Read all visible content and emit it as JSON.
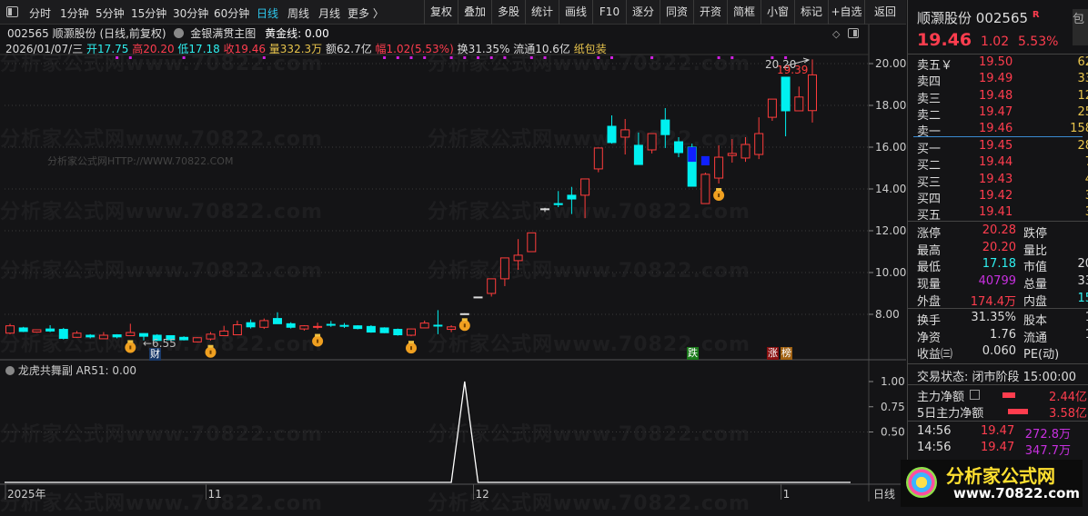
{
  "toolbar": {
    "periods": [
      "分时",
      "1分钟",
      "5分钟",
      "15分钟",
      "30分钟",
      "60分钟",
      "日线",
      "周线",
      "月线",
      "更多 〉"
    ],
    "active_period": "日线",
    "buttons": [
      "复权",
      "叠加",
      "多股",
      "统计",
      "画线",
      "F10",
      "逐分",
      "同资",
      "开资",
      "简框",
      "小窗",
      "标记",
      "+自选",
      "返回"
    ]
  },
  "info": {
    "title": "002565 顺灏股份 (日线,前复权)",
    "indicator": "金银满贯主图",
    "golden_line": "黄金线: 0.00",
    "date": "2026/01/07/三",
    "open": "开17.75",
    "high": "高20.20",
    "low": "低17.18",
    "close": "收19.46",
    "volume": "量332.3万",
    "amount": "额62.7亿",
    "change": "幅1.02(5.53%)",
    "turnover": "换31.35%",
    "float": "流通10.6亿",
    "sector": "纸包装"
  },
  "watermark": "分析家公式网www.70822.com",
  "watermark_small": "分析家公式网HTTP://WWW.70822.COM",
  "chart_data": {
    "type": "candlestick",
    "price_ticks": [
      "20.00",
      "18.00",
      "16.00",
      "14.00",
      "12.00",
      "10.00",
      "8.00"
    ],
    "price_ylim": [
      7.0,
      20.0
    ],
    "candles": [
      [
        7.1,
        7.55,
        7.05,
        7.45
      ],
      [
        7.35,
        7.4,
        7.15,
        7.18
      ],
      [
        7.15,
        7.28,
        7.12,
        7.26
      ],
      [
        7.3,
        7.48,
        7.15,
        7.2
      ],
      [
        7.28,
        7.35,
        6.8,
        6.85
      ],
      [
        6.9,
        7.2,
        6.88,
        7.1
      ],
      [
        7.0,
        7.05,
        6.85,
        6.92
      ],
      [
        6.83,
        7.15,
        6.83,
        7.0
      ],
      [
        7.02,
        7.05,
        6.85,
        6.92
      ],
      [
        6.98,
        7.55,
        6.98,
        7.13
      ],
      [
        7.08,
        7.1,
        6.75,
        6.95
      ],
      [
        7.0,
        7.05,
        6.72,
        6.75
      ],
      [
        6.98,
        7.0,
        6.75,
        6.78
      ],
      [
        6.9,
        6.95,
        6.75,
        6.78
      ],
      [
        6.68,
        6.9,
        6.65,
        6.88
      ],
      [
        6.82,
        7.15,
        6.75,
        7.05
      ],
      [
        6.98,
        7.45,
        6.98,
        7.2
      ],
      [
        7.02,
        7.7,
        7.02,
        7.5
      ],
      [
        7.6,
        7.75,
        7.32,
        7.4
      ],
      [
        7.38,
        7.8,
        7.3,
        7.7
      ],
      [
        7.8,
        8.1,
        7.55,
        7.55
      ],
      [
        7.55,
        7.62,
        7.32,
        7.38
      ],
      [
        7.3,
        7.48,
        7.22,
        7.45
      ],
      [
        7.4,
        7.6,
        7.28,
        7.42
      ],
      [
        7.52,
        7.68,
        7.4,
        7.5
      ],
      [
        7.47,
        7.58,
        7.35,
        7.45
      ],
      [
        7.45,
        7.48,
        7.28,
        7.32
      ],
      [
        7.42,
        7.48,
        7.12,
        7.15
      ],
      [
        7.35,
        7.38,
        7.1,
        7.12
      ],
      [
        7.28,
        7.32,
        6.98,
        7.02
      ],
      [
        7.0,
        7.32,
        6.95,
        7.3
      ],
      [
        7.35,
        7.7,
        7.35,
        7.58
      ],
      [
        7.48,
        8.2,
        7.05,
        7.45
      ],
      [
        7.28,
        7.48,
        7.15,
        7.4
      ],
      [
        8.03,
        8.05,
        8.03,
        8.03
      ],
      [
        8.83,
        8.83,
        8.83,
        8.83
      ],
      [
        9.0,
        9.7,
        8.85,
        9.7
      ],
      [
        9.7,
        10.7,
        9.35,
        10.7
      ],
      [
        10.57,
        11.6,
        10.13,
        10.83
      ],
      [
        11.0,
        11.9,
        11.0,
        11.9
      ],
      [
        13.05,
        13.1,
        12.9,
        13.05
      ],
      [
        13.3,
        13.9,
        13.13,
        13.25
      ],
      [
        13.7,
        14.1,
        12.8,
        13.52
      ],
      [
        13.7,
        14.48,
        12.6,
        14.48
      ],
      [
        14.96,
        15.96,
        14.8,
        15.96
      ],
      [
        17.0,
        17.52,
        16.17,
        16.22
      ],
      [
        16.48,
        17.35,
        15.65,
        16.83
      ],
      [
        16.09,
        16.7,
        15.17,
        15.17
      ],
      [
        15.87,
        16.65,
        15.7,
        16.65
      ],
      [
        17.3,
        17.87,
        15.96,
        16.6
      ],
      [
        16.26,
        16.48,
        15.52,
        15.74
      ],
      [
        16.0,
        16.17,
        14.13,
        14.13
      ],
      [
        13.3,
        14.78,
        13.3,
        14.7
      ],
      [
        14.52,
        16.09,
        14.26,
        15.52
      ],
      [
        15.6,
        16.39,
        15.26,
        15.7
      ],
      [
        15.48,
        16.48,
        15.3,
        16.13
      ],
      [
        15.65,
        17.43,
        15.43,
        16.65
      ],
      [
        17.43,
        18.3,
        17.26,
        18.3
      ],
      [
        19.35,
        19.35,
        16.52,
        17.74
      ],
      [
        17.74,
        18.9,
        17.74,
        18.4
      ],
      [
        17.75,
        20.2,
        17.18,
        19.46
      ]
    ],
    "candle_fields": [
      "open",
      "high",
      "low",
      "close"
    ],
    "neutral_candles": [
      34,
      35,
      40
    ],
    "overlay_blue": [
      [
        51,
        16.0,
        15.3
      ],
      [
        52,
        15.57,
        15.13
      ]
    ],
    "signal_dots": [
      8,
      9,
      13,
      19,
      28,
      29,
      30,
      31,
      33,
      34,
      35,
      36,
      37,
      39,
      40,
      44,
      45,
      48,
      53,
      54,
      57,
      58
    ],
    "moneybag_candles": [
      9,
      15,
      23,
      30,
      34,
      53
    ],
    "annotations": {
      "low_label": "←6.55",
      "high_label": "20.20",
      "high_close_label": "19.39",
      "cai": "财",
      "die": "跌",
      "zhang": "涨",
      "bang": "榜"
    },
    "indicator": {
      "name": "龙虎共舞副",
      "header": "AR51: 0.00",
      "ticks": [
        "1.00",
        "0.75",
        "0.50"
      ],
      "values_nonzero": {
        "34": 1.0
      },
      "ylim": [
        0,
        1.0
      ]
    },
    "x_labels": [
      {
        "label": "2025年",
        "index": 0
      },
      {
        "label": "11",
        "index": 15
      },
      {
        "label": "12",
        "index": 35
      },
      {
        "label": "1",
        "index": 58
      }
    ],
    "period_label": "日线"
  },
  "quote": {
    "name": "顺灏股份",
    "code": "002565",
    "badge": "R",
    "side": "包",
    "price": "19.46",
    "change": "1.02",
    "pct": "5.53%",
    "asks": [
      {
        "label": "卖五￥",
        "price": "19.50",
        "vol": "62"
      },
      {
        "label": "卖四",
        "price": "19.49",
        "vol": "33"
      },
      {
        "label": "卖三",
        "price": "19.48",
        "vol": "12"
      },
      {
        "label": "卖二",
        "price": "19.47",
        "vol": "25"
      },
      {
        "label": "卖一",
        "price": "19.46",
        "vol": "158"
      }
    ],
    "bids": [
      {
        "label": "买一",
        "price": "19.45",
        "vol": "28"
      },
      {
        "label": "买二",
        "price": "19.44",
        "vol": "7"
      },
      {
        "label": "买三",
        "price": "19.43",
        "vol": "4"
      },
      {
        "label": "买四",
        "price": "19.42",
        "vol": "3"
      },
      {
        "label": "买五",
        "price": "19.41",
        "vol": "3"
      }
    ],
    "stats": [
      {
        "l": "涨停",
        "v": "20.28",
        "c": "red",
        "l2": "跌停",
        "v2": ""
      },
      {
        "l": "最高",
        "v": "20.20",
        "c": "red",
        "l2": "量比",
        "v2": ""
      },
      {
        "l": "最低",
        "v": "17.18",
        "c": "cyan",
        "l2": "市值",
        "v2": "20"
      },
      {
        "l": "现量",
        "v": "40799",
        "c": "mag",
        "l2": "总量",
        "v2": "33"
      },
      {
        "l": "外盘",
        "v": "174.4万",
        "c": "red",
        "l2": "内盘",
        "v2": "15"
      }
    ],
    "stats2": [
      {
        "l": "换手",
        "v": "31.35%",
        "l2": "股本",
        "v2": "1"
      },
      {
        "l": "净资",
        "v": "1.76",
        "l2": "流通",
        "v2": "1"
      },
      {
        "l": "收益㈢",
        "v": "0.060",
        "l2": "PE(动)",
        "v2": ""
      }
    ],
    "status": "交易状态: 闭市阶段 15:00:00",
    "flows": [
      {
        "l": "主力净额",
        "v": "2.44亿"
      },
      {
        "l": "5日主力净额",
        "v": "3.58亿"
      }
    ],
    "ticks": [
      {
        "t": "14:56",
        "p": "19.47",
        "v": "272.8万"
      },
      {
        "t": "14:56",
        "p": "19.47",
        "v": "347.7万"
      }
    ],
    "logo_text": "分析家公式网",
    "logo_url": "www.70822.com"
  },
  "colors": {
    "up": "#ff3c3c",
    "down": "#00f0f0",
    "blue": "#1020ff",
    "accent": "#2ec9f0"
  }
}
